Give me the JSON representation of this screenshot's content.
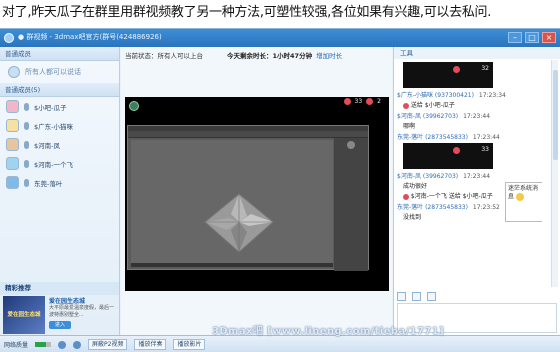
{
  "caption": "对了,昨天瓜子在群里用群视频教了另一种方法,可塑性较强,各位如果有兴趣,可以去私问.",
  "window": {
    "title": "● 群视频 - 3dmax吧官方(群号(424886926)"
  },
  "left_panel": {
    "section_title": "普通成员",
    "broadcast_text": "所有人都可以说话",
    "members_header": "普通成员(5)",
    "members": [
      {
        "name": "$小吧-瓜子"
      },
      {
        "name": "$广东-小猫咪"
      },
      {
        "name": "$河南-凤"
      },
      {
        "name": "$河南-一个飞"
      },
      {
        "name": "东莞-落叶"
      }
    ],
    "promo": {
      "header": "精彩推荐",
      "thumb_text": "爱在园生态城",
      "title": "爱在园生态城",
      "desc": "大平原最爱温泉度假，最后一波特惠别墅全...",
      "enter": "进入"
    }
  },
  "center": {
    "status_label": "当前状态：所有人可以上台",
    "time_left": "今天剩余时长：1小时47分钟",
    "add_time": "增加时长",
    "video_badge_count": "33",
    "video_flower_count": "2"
  },
  "bottom": {
    "network_label": "网络质量",
    "share_label": "屏蔽P2视频",
    "play_label": "播放伴奏",
    "movie_label": "播放影片"
  },
  "watermark": "3Dmax吧 [www.lineng.com/tieba/1771]",
  "chat": {
    "panel_title": "工具",
    "messages": [
      {
        "sender": "$广东-小猫咪",
        "qq": "(937300421)",
        "time": "17:23:34",
        "shot": "32"
      },
      {
        "sender": "$小吧-瓜子",
        "text": "送给 $小吧-瓜子",
        "time": ""
      },
      {
        "sender": "$河南-凤",
        "qq": "(39962703)",
        "time": "17:23:44",
        "text": "哪啊"
      },
      {
        "sender": "东莞-落叶",
        "qq": "(2873545833)",
        "time": "17:23:44"
      },
      {
        "sender": "$河南-凤",
        "qq": "(39962703)",
        "time": "17:23:44",
        "shot": "33"
      },
      {
        "sender": "",
        "text": "成功很好"
      },
      {
        "sender": "$河南-一个飞",
        "text": "送给 $小吧-瓜子"
      },
      {
        "sender": "东莞-落叶",
        "qq": "(2873545833)",
        "time": "17:23:52",
        "text": "没找到"
      }
    ],
    "popup_text": "迷茫系统消息"
  }
}
